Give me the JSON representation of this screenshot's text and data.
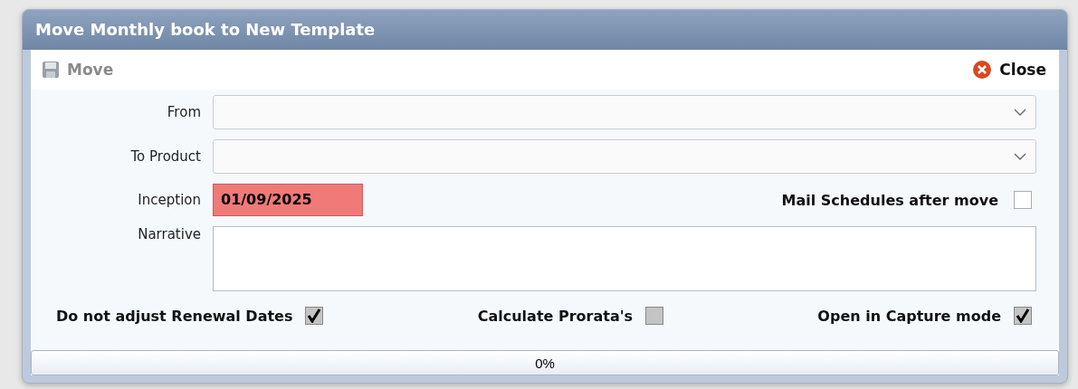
{
  "window": {
    "title": "Move Monthly book to New Template"
  },
  "toolbar": {
    "move": {
      "label": "Move",
      "disabled": true
    },
    "close": {
      "label": "Close"
    }
  },
  "from": {
    "label": "From"
  },
  "to_product": {
    "label": "To Product"
  },
  "inception": {
    "label": "Inception",
    "value": "01/09/2025",
    "invalid": true
  },
  "mail_schedules": {
    "label": "Mail Schedules after move",
    "checked": false,
    "disabled": false
  },
  "narrative": {
    "label": "Narrative"
  },
  "options": [
    {
      "label": "Do not adjust Renewal Dates",
      "checked": true,
      "disabled": true
    },
    {
      "label": "Calculate Prorata's",
      "checked": false,
      "disabled": true
    },
    {
      "label": "Open in Capture mode",
      "checked": true,
      "disabled": true
    }
  ],
  "progress": {
    "level": 0,
    "reading": "0%"
  }
}
